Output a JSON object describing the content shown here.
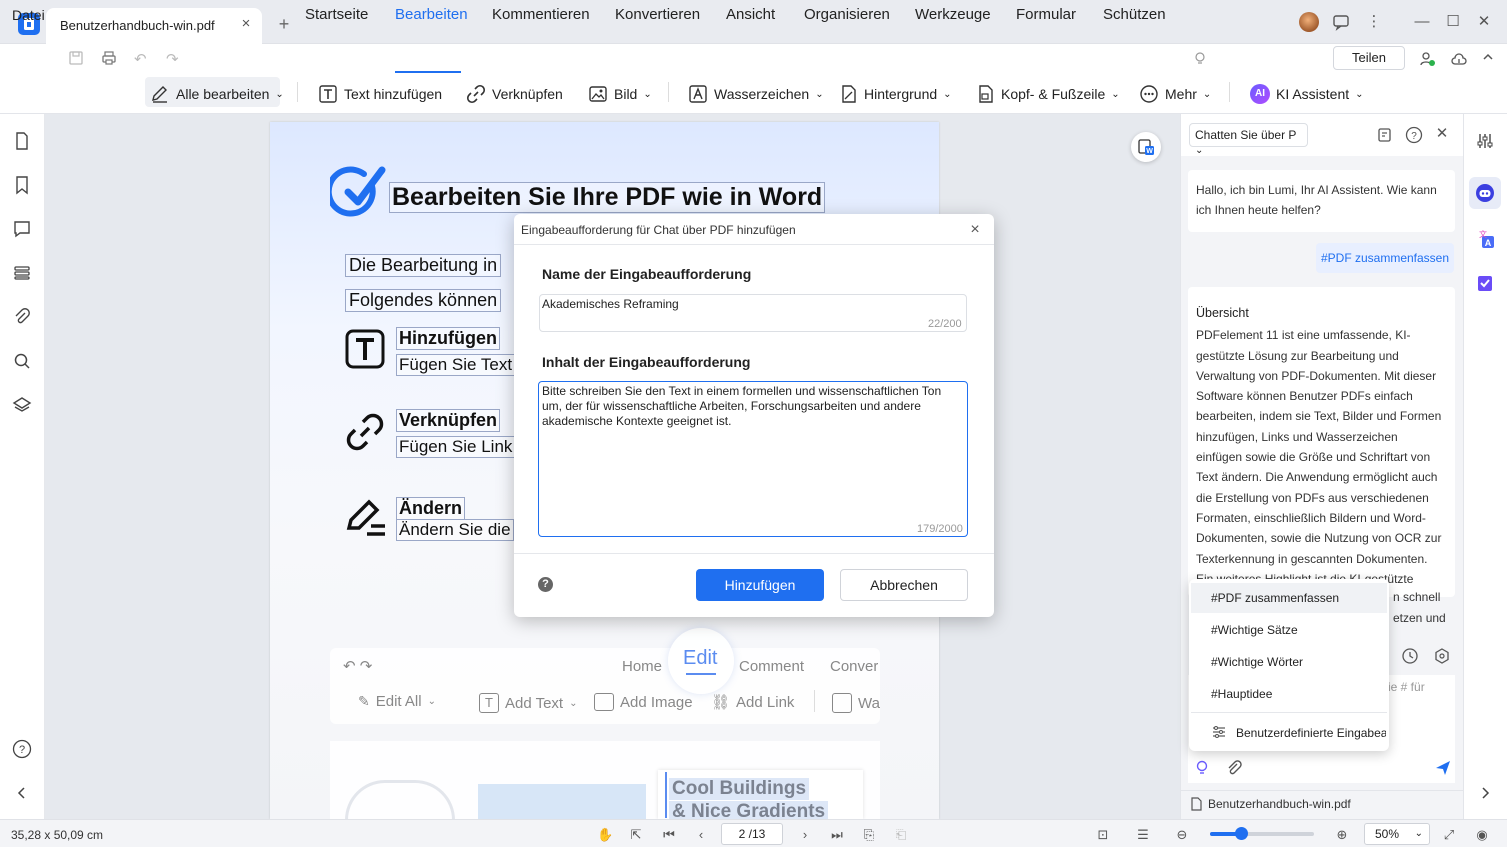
{
  "titlebar": {
    "tab_title": "Benutzerhandbuch-win.pdf",
    "tab_close": "×",
    "new_tab": "+"
  },
  "menu": {
    "datei": "Datei",
    "items": [
      "Startseite",
      "Bearbeiten",
      "Kommentieren",
      "Konvertieren",
      "Ansicht",
      "Organisieren",
      "Werkzeuge",
      "Formular",
      "Schützen"
    ],
    "active": "Bearbeiten",
    "share": "Teilen"
  },
  "toolbar": {
    "alle_bearbeiten": "Alle bearbeiten",
    "text_hinzufuegen": "Text hinzufügen",
    "verknuepfen": "Verknüpfen",
    "bild": "Bild",
    "wasserzeichen": "Wasserzeichen",
    "hintergrund": "Hintergrund",
    "kopf_fusszeile": "Kopf- & Fußzeile",
    "mehr": "Mehr",
    "ki_badge": "AI",
    "ki_assistent": "KI Assistent"
  },
  "page": {
    "heading": "Bearbeiten Sie Ihre PDF wie in Word",
    "line1": "Die Bearbeitung in",
    "line2": "Folgendes können",
    "add_title": "Hinzufügen",
    "add_text": "Fügen Sie Text",
    "link_title": "Verknüpfen",
    "link_text": "Fügen Sie Link",
    "edit_title": "Ändern",
    "edit_text": "Ändern Sie die",
    "inner_tabs": [
      "Home",
      "Edit",
      "Comment",
      "Convert"
    ],
    "inner_tools": [
      "Edit All",
      "Add Text",
      "Add Image",
      "Add Link",
      "Wa"
    ],
    "cool_line1": "Cool Buildings",
    "cool_line2": "& Nice Gradients"
  },
  "dialog": {
    "title": "Eingabeaufforderung für Chat über PDF hinzufügen",
    "close": "×",
    "name_label": "Name der Eingabeaufforderung",
    "name_value": "Akademisches Reframing",
    "name_count": "22/200",
    "content_label": "Inhalt der Eingabeaufforderung",
    "content_value": "Bitte schreiben Sie den Text in einem formellen und wissenschaftlichen Ton um, der für wissenschaftliche Arbeiten, Forschungsarbeiten und andere akademische Kontexte geeignet ist.",
    "content_count": "179/2000",
    "help": "?",
    "add_button": "Hinzufügen",
    "cancel_button": "Abbrechen"
  },
  "assistant": {
    "mode_select": "Chatten Sie über P",
    "hello": "Hallo, ich bin Lumi, Ihr AI Assistent. Wie kann ich Ihnen heute helfen?",
    "user_tag": "#PDF zusammenfassen",
    "summary_title": "Übersicht",
    "summary_text": "PDFelement 11 ist eine umfassende, KI-gestützte Lösung zur Bearbeitung und Verwaltung von PDF-Dokumenten. Mit dieser Software können Benutzer PDFs einfach bearbeiten, indem sie Text, Bilder und Formen hinzufügen, Links und Wasserzeichen einfügen sowie die Größe und Schriftart von Text ändern. Die Anwendung ermöglicht auch die Erstellung von PDFs aus verschiedenen Formaten, einschließlich Bildern und Word-Dokumenten, sowie die Nutzung von OCR zur Texterkennung in gescannten Dokumenten. Ein weiteres Highlight ist die KI-gestützte Unterstützung, die",
    "summary_tail1": "n schnell",
    "summary_tail2": "etzen und",
    "input_placeholder": "ie # für",
    "prompt_menu": [
      "#PDF zusammenfassen",
      "#Wichtige Sätze",
      "#Wichtige Wörter",
      "#Hauptidee"
    ],
    "custom_prompts": "Benutzerdefinierte Eingabea",
    "file_name": "Benutzerhandbuch-win.pdf"
  },
  "status": {
    "dimensions": "35,28 x 50,09 cm",
    "page_indicator": "2 /13",
    "zoom": "50%",
    "zoom_fraction": 0.3
  },
  "colors": {
    "accent": "#1f6ff0"
  }
}
